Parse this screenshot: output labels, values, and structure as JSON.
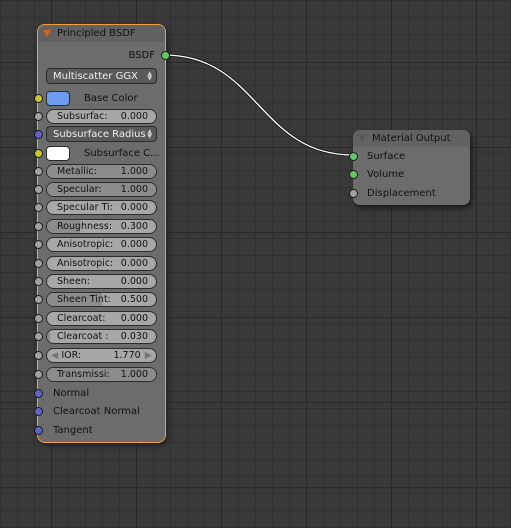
{
  "colors": {
    "link": "#ffffff",
    "selected_outline": "#f0a040",
    "base_color_swatch": "#6d9cf0",
    "subsurface_color_swatch": "#ffffff"
  },
  "principled": {
    "title": "Principled BSDF",
    "output_label": "BSDF",
    "distribution": "Multiscatter GGX",
    "base_color_label": "Base Color",
    "subsurface": {
      "label": "Subsurfac:",
      "value": "0.000",
      "fraction": 0.0
    },
    "subsurface_radius": "Subsurface Radius",
    "subsurface_color_label": "Subsurface C...",
    "sliders": [
      {
        "label": "Metallic:",
        "value": "1.000",
        "fraction": 1.0
      },
      {
        "label": "Specular:",
        "value": "1.000",
        "fraction": 1.0
      },
      {
        "label": "Specular Ti:",
        "value": "0.000",
        "fraction": 0.0
      },
      {
        "label": "Roughness:",
        "value": "0.300",
        "fraction": 0.3
      },
      {
        "label": "Anisotropic:",
        "value": "0.000",
        "fraction": 0.0
      },
      {
        "label": "Anisotropic:",
        "value": "0.000",
        "fraction": 0.0
      },
      {
        "label": "Sheen:",
        "value": "0.000",
        "fraction": 0.0
      },
      {
        "label": "Sheen Tint:",
        "value": "0.500",
        "fraction": 0.5
      },
      {
        "label": "Clearcoat:",
        "value": "0.000",
        "fraction": 0.0
      },
      {
        "label": "Clearcoat :",
        "value": "0.030",
        "fraction": 0.03
      }
    ],
    "ior": {
      "label": "IOR:",
      "value": "1.770"
    },
    "transmission": {
      "label": "Transmissi:",
      "value": "1.000",
      "fraction": 1.0
    },
    "vector_inputs": [
      "Normal",
      "Clearcoat Normal",
      "Tangent"
    ]
  },
  "material_output": {
    "title": "Material Output",
    "inputs": [
      "Surface",
      "Volume",
      "Displacement"
    ]
  }
}
